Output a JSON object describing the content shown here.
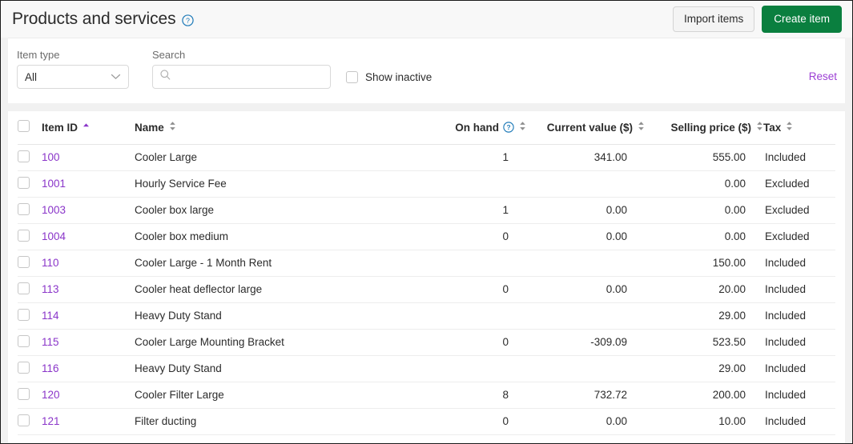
{
  "header": {
    "title": "Products and services",
    "help_icon": "help-circle-icon",
    "import_label": "Import items",
    "create_label": "Create item"
  },
  "filters": {
    "item_type_label": "Item type",
    "item_type_value": "All",
    "item_type_options": [
      "All"
    ],
    "search_label": "Search",
    "search_value": "",
    "search_placeholder": "",
    "search_icon": "search-icon",
    "show_inactive_label": "Show inactive",
    "show_inactive_checked": false,
    "reset_label": "Reset"
  },
  "table": {
    "columns": [
      {
        "key": "item_id",
        "label": "Item ID",
        "sort": "asc",
        "align": "left"
      },
      {
        "key": "name",
        "label": "Name",
        "sort": "none",
        "align": "left"
      },
      {
        "key": "on_hand",
        "label": "On hand",
        "sort": "none",
        "align": "right",
        "help_icon": "help-circle-icon"
      },
      {
        "key": "current_value",
        "label": "Current value ($)",
        "sort": "none",
        "align": "right"
      },
      {
        "key": "selling_price",
        "label": "Selling price ($)",
        "sort": "none",
        "align": "right"
      },
      {
        "key": "tax",
        "label": "Tax",
        "sort": "none",
        "align": "left"
      }
    ],
    "select_all_checked": false,
    "rows": [
      {
        "item_id": "100",
        "name": "Cooler Large",
        "on_hand": "1",
        "current_value": "341.00",
        "selling_price": "555.00",
        "tax": "Included"
      },
      {
        "item_id": "1001",
        "name": "Hourly Service Fee",
        "on_hand": "",
        "current_value": "",
        "selling_price": "0.00",
        "tax": "Excluded"
      },
      {
        "item_id": "1003",
        "name": "Cooler box large",
        "on_hand": "1",
        "current_value": "0.00",
        "selling_price": "0.00",
        "tax": "Excluded"
      },
      {
        "item_id": "1004",
        "name": "Cooler box medium",
        "on_hand": "0",
        "current_value": "0.00",
        "selling_price": "0.00",
        "tax": "Excluded"
      },
      {
        "item_id": "110",
        "name": "Cooler Large - 1 Month Rent",
        "on_hand": "",
        "current_value": "",
        "selling_price": "150.00",
        "tax": "Included"
      },
      {
        "item_id": "113",
        "name": "Cooler heat deflector large",
        "on_hand": "0",
        "current_value": "0.00",
        "selling_price": "20.00",
        "tax": "Included"
      },
      {
        "item_id": "114",
        "name": "Heavy Duty Stand",
        "on_hand": "",
        "current_value": "",
        "selling_price": "29.00",
        "tax": "Included"
      },
      {
        "item_id": "115",
        "name": "Cooler Large Mounting Bracket",
        "on_hand": "0",
        "current_value": "-309.09",
        "selling_price": "523.50",
        "tax": "Included"
      },
      {
        "item_id": "116",
        "name": "Heavy Duty Stand",
        "on_hand": "",
        "current_value": "",
        "selling_price": "29.00",
        "tax": "Included"
      },
      {
        "item_id": "120",
        "name": "Cooler Filter Large",
        "on_hand": "8",
        "current_value": "732.72",
        "selling_price": "200.00",
        "tax": "Included"
      },
      {
        "item_id": "121",
        "name": "Filter ducting",
        "on_hand": "0",
        "current_value": "0.00",
        "selling_price": "10.00",
        "tax": "Included"
      }
    ]
  },
  "colors": {
    "primary_button": "#0a7f3f",
    "link": "#8a35c9",
    "reset_link": "#9c3fd4",
    "help_icon": "#1e7ab8",
    "active_sort": "#8a35c9"
  }
}
